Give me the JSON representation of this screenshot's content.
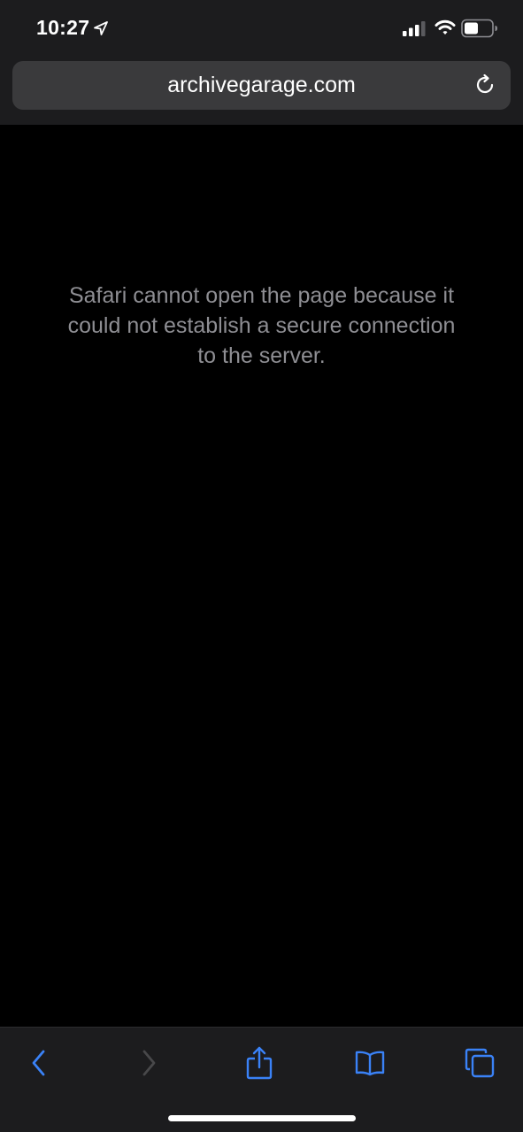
{
  "status_bar": {
    "time": "10:27",
    "icons": [
      "location-arrow-icon",
      "cellular-signal-icon",
      "wifi-icon",
      "battery-icon"
    ]
  },
  "address_bar": {
    "url": "archivegarage.com",
    "reload_icon": "reload-icon"
  },
  "content": {
    "error_message": "Safari cannot open the page because it could not establish a secure connection to the server."
  },
  "toolbar": {
    "items": [
      {
        "name": "back-button",
        "icon": "chevron-left-icon",
        "enabled": true
      },
      {
        "name": "forward-button",
        "icon": "chevron-right-icon",
        "enabled": false
      },
      {
        "name": "share-button",
        "icon": "share-icon",
        "enabled": true
      },
      {
        "name": "bookmarks-button",
        "icon": "book-icon",
        "enabled": true
      },
      {
        "name": "tabs-button",
        "icon": "tabs-icon",
        "enabled": true
      }
    ]
  },
  "colors": {
    "background": "#000000",
    "chrome": "#1c1c1e",
    "address_field": "#3a3a3c",
    "accent": "#3a82f7",
    "disabled": "#48484a",
    "message_text": "#8e8e93"
  }
}
